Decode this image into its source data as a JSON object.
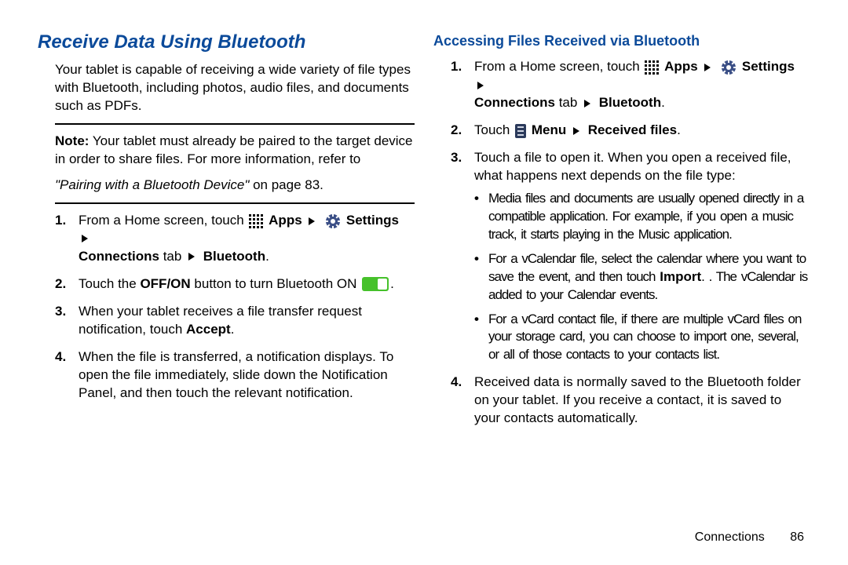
{
  "left": {
    "title": "Receive Data Using Bluetooth",
    "intro": "Your tablet is capable of receiving a wide variety of file types with Bluetooth, including photos, audio files, and documents such as PDFs.",
    "note_label": "Note:",
    "note_body": "Your tablet must already be paired to the target device in order to share files. For more information, refer to",
    "cross_ref_italic": "\"Pairing with a Bluetooth Device\"",
    "cross_ref_tail": " on page 83.",
    "steps": {
      "s1_lead": "From a Home screen, touch ",
      "apps_label": "Apps",
      "settings_label": "Settings",
      "s1_line2a": "Connections",
      "s1_line2b": " tab ",
      "s1_line2c": "Bluetooth",
      "s2_a": "Touch the ",
      "s2_b": "OFF/ON",
      "s2_c": " button to turn Bluetooth ON ",
      "s3_a": "When your tablet receives a file transfer request notification, touch ",
      "s3_b": "Accept",
      "s4": "When the file is transferred, a notification displays. To open the file immediately, slide down the Notification Panel, and then touch the relevant notification."
    }
  },
  "right": {
    "subtitle": "Accessing Files Received via Bluetooth",
    "steps": {
      "s1_lead": "From a Home screen, touch ",
      "apps_label": "Apps",
      "settings_label": "Settings",
      "s1_line2a": "Connections",
      "s1_line2b": " tab ",
      "s1_line2c": "Bluetooth",
      "s2_a": "Touch ",
      "s2_menu": "Menu",
      "s2_b": "Received files",
      "s3_a": "Touch a file to open it. When you open a received file, what happens next depends on the file type:",
      "bullets": {
        "b1": "Media files and documents are usually opened directly in a compatible application. For example, if you open a music track, it starts playing in the Music application.",
        "b2a": "For a vCalendar file, select the calendar where you want to save the event, and then touch ",
        "b2b": "Import",
        "b2c": ". The vCalendar is added to your Calendar events.",
        "b3": "For a vCard contact file, if there are multiple vCard files on your storage card, you can choose to import one, several, or all of those contacts to your contacts list."
      },
      "s4": "Received data is normally saved to the Bluetooth folder on your tablet. If you receive a contact, it is saved to your contacts automatically."
    }
  },
  "footer": {
    "section": "Connections",
    "page": "86"
  }
}
